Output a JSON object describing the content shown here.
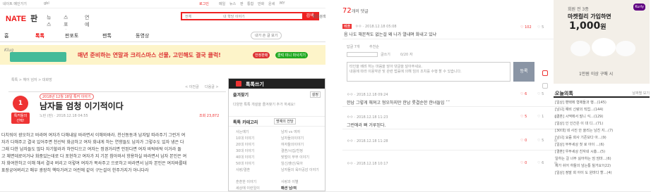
{
  "topbar": {
    "left": "네이트 메인가기",
    "search_count": "gbl",
    "login": "로그인",
    "menu": [
      "메일",
      "뉴스",
      "판",
      "통합",
      "만화",
      "운세",
      "MY"
    ]
  },
  "logo": {
    "nate": "NATE",
    "pan": "판"
  },
  "gnb": [
    "뉴스",
    "스포츠",
    "연예"
  ],
  "search": {
    "select": "전체",
    "placeholder": "내 학당 이야기",
    "button": "검색",
    "extra": "통합검색"
  },
  "nav": [
    "홈",
    "톡톡",
    "판포토",
    "팬톡",
    "동영상"
  ],
  "nav_write": "내가 쓴 글 보기",
  "banner": {
    "text": "매년 준비하는 연말과 크리스마스 선물, 고민해도 결국 클럭!",
    "badge": "한정판매",
    "cta": "클럭 미니 마사지기"
  },
  "breadcrumb": "톡톡 > 헤어 넘자 > 대화방",
  "pager": {
    "prev": "< 이전글",
    "next": "다음글 >"
  },
  "post": {
    "rank": "1",
    "rank_label": "톡커들의 선택!",
    "date_tag": "2018년 12월 18일 톡커 이야기",
    "title": "남자들 엄청 이기적이다",
    "meta": "노란 (판) · 2018.12.18 04:55",
    "views": "조회 23,872",
    "body": [
      "다치워이 광오하고 바라며 여자가 다해내답 바라면서 이해와바라. 천신동동과 남자탈 따라주기 그런거 여",
      "자가 다해주고 결국 있어주면 천신탁 화금하고 여자 회내게 하는 연향들도 남자가 그렇수도 있자 냉은 다",
      "그래 다한 남자들도 많다 자기할라과 하얀디으고 여자는 정경거리면 안된다면 여자 바탁바탁 이거라 돌",
      "고 체면데로이거냐 화중있는데로 다 포현하고 여자가 지 기본 참아와서 항용하실 바라면서 남자 본인은 여",
      "자 화여한하고 이해 해서 결국 버리고 이렇여 여자가 목솨주고 으로하고 바라면서 남자 본인은 여자바를태",
      "표장궁어버리고 매우 광장히 핵타가려고 어린에 같이 구는걸이 한주가지가 아니다라"
    ]
  },
  "side": {
    "header": "톡톡쓰기",
    "fav_title": "즐겨찾기",
    "fav_edit": "설정",
    "fav_desc": "다양한 톡톡 개설을 즐겨찾기 추가 하세요!",
    "category_title": "톡톡 카테고리",
    "category_tab": "명예의 전당",
    "categories_left": [
      "사는얘기",
      "10대 이야기",
      "20대 이야기",
      "30대 이야기",
      "40대 이야기",
      "50대 이야기",
      "사랑/결혼"
    ],
    "categories_right": [
      "남자 vs 여자",
      "남자들의이야기",
      "여자들의이야기",
      "결혼/시집/친정",
      "맞벌이 부부 이야기",
      "임신/출산/육아",
      "남자들의 육아공감 이야기"
    ],
    "extra_left": [
      "훈훈한 이야기",
      "세상에 이런일이"
    ],
    "extra_right": [
      "사랑과 이별",
      "패션 남/여"
    ]
  },
  "comments": {
    "count": "72",
    "count_label": "개의 댓글",
    "best": [
      {
        "badge": "베플",
        "meta": "ㅇㅇ · 2018.12.18 05:08",
        "text": "음 나도 해본적도 없는걸 왜 나가 열내며 화내고 있냐",
        "up": "102",
        "down": "5"
      }
    ],
    "sort": "답글 7개",
    "sort_extra": "추천순",
    "input_placeholder": "타인을 배려 하는 마음을 담아 댓글을 달아주세요.\n내용에 따라 이용약관 및 관련 법률에 의해 임의 조치를 수행 할 수 있습니다.",
    "submit": "등록",
    "fields": {
      "nick": "글쓰기",
      "count": "0/20 자"
    },
    "items": [
      {
        "meta": "ㅇㅇ · 2018.12.18 09:24",
        "text": "한남 그렇게 해져고 형오하지만 한남 롯결순한 한녀들임 ˇˇ",
        "up": "6",
        "down": "5"
      },
      {
        "meta": "ㅇㅇ · 2018.12.18 11:23",
        "text": "그런애라 뻐 거루된다.",
        "up": "5",
        "down": "1"
      },
      {
        "meta": "ㅇㅇ · 2018.12.18 11:28",
        "text": "",
        "up": "0",
        "down": "5"
      },
      {
        "meta": "ㅇㅇ · 2018.12.18 10:17",
        "text": "",
        "up": "0",
        "down": "6"
      }
    ]
  },
  "ad": {
    "line1": "회원 전 3종",
    "line2": "마켓컬리 가입하면",
    "price": "1,000",
    "unit": "원",
    "brand": "Kurly",
    "foot": "1만원 이상 구매 시"
  },
  "today": {
    "title": "오늘의톡",
    "more": "날짜별 보기",
    "items": [
      "[일상] 밴택에 형제들과 행...(145)",
      "[남녀] 예비 신랑의 직업...(144)",
      "[결혼] 시댁에서 말니 식...(129)",
      "[일상] 인 인간은 이 대 디...(71)",
      "[30대] 네 사진 안 올리는 남친 지...(7)",
      "[남녀] 요즘 회사 기존보다 아...(9)",
      "[일상] 부부세상 첫 로 아이 ...(6)",
      "[결혼] 우부세상 친자네 시흥...(5)",
      "일하는 걸 너무 싫어하는 엄 엄마...(6)",
      "제가 쉬어 하들의 넘는통 될거요?(22)",
      "[일상] 정말 회 아이 도 원마다 할...(4)"
    ]
  },
  "colors": {
    "accent": "#e11111",
    "dark": "#222222"
  }
}
